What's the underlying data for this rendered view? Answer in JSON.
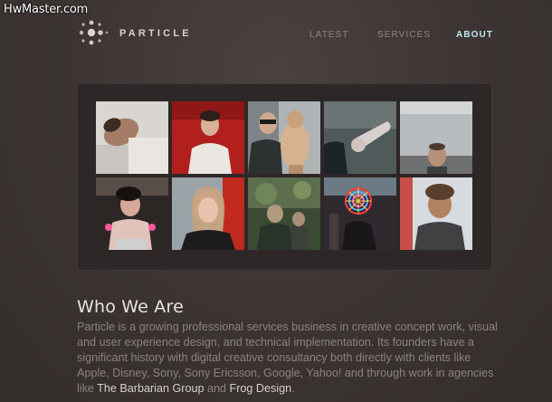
{
  "watermark": "HwMaster.com",
  "brand": {
    "name": "PARTICLE"
  },
  "nav": [
    {
      "label": "LATEST"
    },
    {
      "label": "SERVICES"
    },
    {
      "label": "ABOUT"
    }
  ],
  "about": {
    "heading": "Who We Are",
    "paragraph_before_link1": "Particle is a growing professional services business in creative concept work, visual and user experience design, and technical implementation. Its founders have a significant history with digital creative consultancy both directly with clients like Apple, Disney, Sony, Sony Ericsson, Google, Yahoo! and through work in agencies like ",
    "link1": "The Barbarian Group",
    "between_links": " and ",
    "link2": "Frog Design",
    "after_link2": "."
  },
  "colors": {
    "accent_nav_active": "#bfe7ee",
    "background": "#3b3432",
    "panel": "#2d2827"
  }
}
